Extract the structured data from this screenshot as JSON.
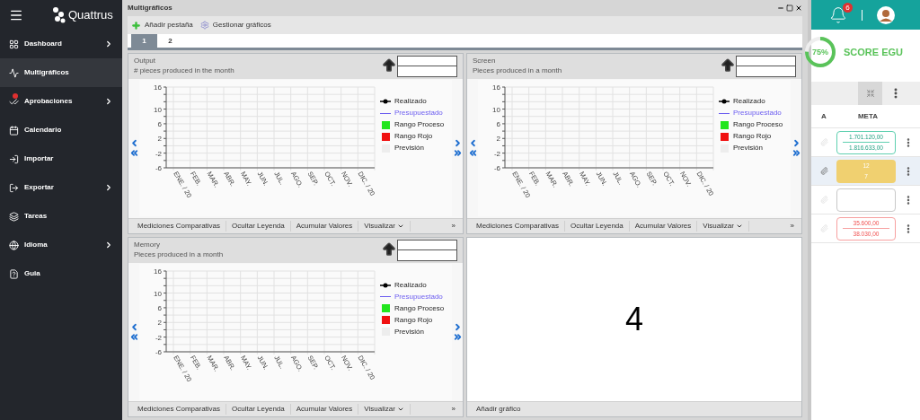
{
  "sidebar": {
    "logo": "Quattrus",
    "items": [
      {
        "label": "Dashboard",
        "selected": false,
        "submenu": true
      },
      {
        "label": "Multigráficos",
        "selected": true,
        "submenu": false
      },
      {
        "label": "Aprobaciones",
        "selected": false,
        "submenu": true
      },
      {
        "label": "Calendario",
        "selected": false,
        "submenu": false
      },
      {
        "label": "Importar",
        "selected": false,
        "submenu": false
      },
      {
        "label": "Exportar",
        "selected": false,
        "submenu": true
      },
      {
        "label": "Tareas",
        "selected": false,
        "submenu": false
      },
      {
        "label": "Idioma",
        "selected": false,
        "submenu": true
      },
      {
        "label": "Guia",
        "selected": false,
        "submenu": false
      }
    ]
  },
  "window": {
    "title": "Multigráficos",
    "toolbar": [
      "Añadir pestaña",
      "Gestionar gráficos"
    ],
    "tabs": [
      {
        "label": "1",
        "selected": true
      },
      {
        "label": "2",
        "selected": false
      }
    ],
    "panels": [
      {
        "kind": "chart",
        "title": "Output",
        "subtitle": "# pieces produced in the month",
        "chart_data": {
          "type": "line",
          "grid": true,
          "categories": [
            "ENE. / 20",
            "FEB.",
            "MAR.",
            "ABR.",
            "MAY.",
            "JUN.",
            "JUL.",
            "AGO.",
            "SEP.",
            "OCT.",
            "NOV.",
            "DIC. / 20"
          ],
          "ylim": [
            -6,
            16
          ],
          "yticks": [
            -6,
            -2,
            2,
            6,
            10,
            16
          ]
        },
        "legend": [
          {
            "label": "Realizado",
            "kind": "dot-line",
            "color": "#000000"
          },
          {
            "label": "Presupuestado",
            "kind": "line",
            "color": "#6b5cf0"
          },
          {
            "label": "Rango Proceso",
            "kind": "square",
            "color": "#22e61e"
          },
          {
            "label": "Rango Rojo",
            "kind": "square",
            "color": "#f01010"
          },
          {
            "label": "Previsión",
            "kind": "square",
            "color": "#ededed"
          }
        ],
        "footer": [
          "Mediciones Comparativas",
          "Ocultar Leyenda",
          "Acumular Valores",
          "Visualizar"
        ],
        "more": "»"
      },
      {
        "kind": "chart",
        "title": "Screen",
        "subtitle": "Pieces produced in a month",
        "chart_data": {
          "type": "line",
          "grid": true,
          "categories": [
            "ENE. / 20",
            "FEB.",
            "MAR.",
            "ABR.",
            "MAY.",
            "JUN.",
            "JUL.",
            "AGO.",
            "SEP.",
            "OCT.",
            "NOV.",
            "DIC. / 20"
          ],
          "ylim": [
            -6,
            16
          ],
          "yticks": [
            -6,
            -2,
            2,
            6,
            10,
            16
          ]
        },
        "legend": [
          {
            "label": "Realizado",
            "kind": "dot-line",
            "color": "#000000"
          },
          {
            "label": "Presupuestado",
            "kind": "line",
            "color": "#6b5cf0"
          },
          {
            "label": "Rango Proceso",
            "kind": "square",
            "color": "#22e61e"
          },
          {
            "label": "Rango Rojo",
            "kind": "square",
            "color": "#f01010"
          },
          {
            "label": "Previsión",
            "kind": "square",
            "color": "#ededed"
          }
        ],
        "footer": [
          "Mediciones Comparativas",
          "Ocultar Leyenda",
          "Acumular Valores",
          "Visualizar"
        ],
        "more": "»"
      },
      {
        "kind": "chart",
        "title": "Memory",
        "subtitle": "Pieces produced in a month",
        "chart_data": {
          "type": "line",
          "grid": true,
          "categories": [
            "ENE. / 20",
            "FEB.",
            "MAR.",
            "ABR.",
            "MAY.",
            "JUN.",
            "JUL.",
            "AGO.",
            "SEP.",
            "OCT.",
            "NOV.",
            "DIC. / 20"
          ],
          "ylim": [
            -6,
            16
          ],
          "yticks": [
            -6,
            -2,
            2,
            6,
            10,
            16
          ]
        },
        "legend": [
          {
            "label": "Realizado",
            "kind": "dot-line",
            "color": "#000000"
          },
          {
            "label": "Presupuestado",
            "kind": "line",
            "color": "#6b5cf0"
          },
          {
            "label": "Rango Proceso",
            "kind": "square",
            "color": "#22e61e"
          },
          {
            "label": "Rango Rojo",
            "kind": "square",
            "color": "#f01010"
          },
          {
            "label": "Previsión",
            "kind": "square",
            "color": "#ededed"
          }
        ],
        "footer": [
          "Mediciones Comparativas",
          "Ocultar Leyenda",
          "Acumular Valores",
          "Visualizar"
        ],
        "more": "»"
      },
      {
        "kind": "empty",
        "number": "4",
        "footer": [
          "Añadir gráfico"
        ]
      }
    ]
  },
  "right_panel": {
    "badge": "6",
    "score": {
      "percent": "75%",
      "level": 0.75,
      "label": "SCORE EGU"
    },
    "columns": [
      "A",
      "META"
    ],
    "rows": [
      {
        "attached": false,
        "selected": false,
        "kind": "green",
        "values": [
          "1.701.120,00",
          "1.816.633,00"
        ]
      },
      {
        "attached": true,
        "selected": true,
        "kind": "yellow",
        "values": [
          "12",
          "7"
        ]
      },
      {
        "attached": false,
        "selected": false,
        "kind": "empty",
        "values": []
      },
      {
        "attached": false,
        "selected": false,
        "kind": "red",
        "values": [
          "35.600,00",
          "38.030,00"
        ]
      }
    ]
  }
}
